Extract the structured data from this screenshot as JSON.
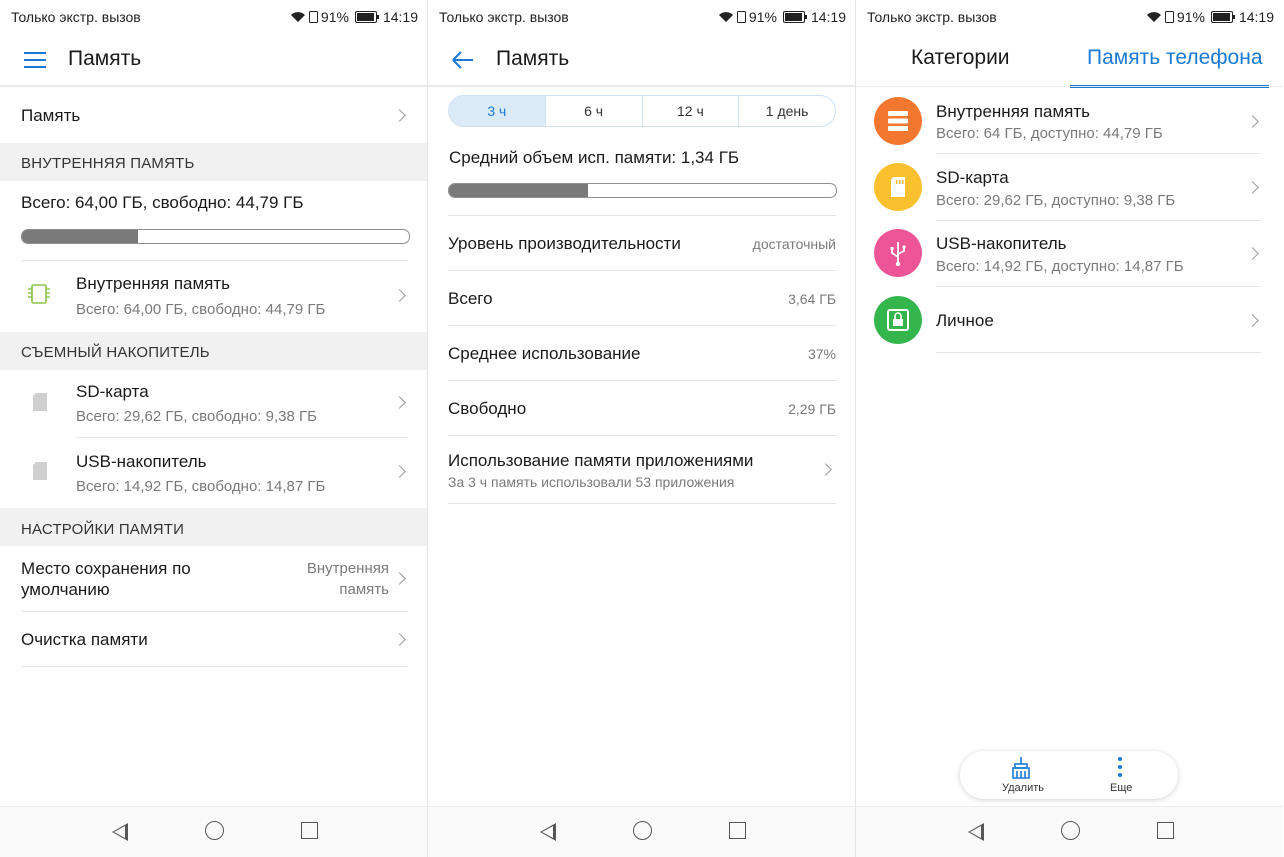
{
  "status": {
    "carrier": "Только экстр. вызов",
    "battery": "91%",
    "time": "14:19"
  },
  "screen1": {
    "title": "Память",
    "memory_row": "Память",
    "section_internal": "ВНУТРЕННЯЯ ПАМЯТЬ",
    "internal_summary": "Всего: 64,00 ГБ, свободно: 44,79 ГБ",
    "internal_used_fraction": 0.3,
    "internal_item": {
      "title": "Внутренняя память",
      "sub": "Всего: 64,00 ГБ, свободно: 44,79 ГБ"
    },
    "section_removable": "СЪЕМНЫЙ НАКОПИТЕЛЬ",
    "sd": {
      "title": "SD-карта",
      "sub": "Всего: 29,62 ГБ, свободно: 9,38 ГБ"
    },
    "usb": {
      "title": "USB-накопитель",
      "sub": "Всего: 14,92 ГБ, свободно: 14,87 ГБ"
    },
    "section_settings": "НАСТРОЙКИ ПАМЯТИ",
    "default_location": {
      "title": "Место сохранения по умолчанию",
      "value": "Внутренняя память"
    },
    "cleanup": "Очистка памяти"
  },
  "screen2": {
    "title": "Память",
    "ranges": [
      "3 ч",
      "6 ч",
      "12 ч",
      "1 день"
    ],
    "avg_usage": "Средний объем исп. памяти: 1,34 ГБ",
    "avg_usage_fraction": 0.36,
    "performance": {
      "label": "Уровень производительности",
      "value": "достаточный"
    },
    "total": {
      "label": "Всего",
      "value": "3,64 ГБ"
    },
    "average": {
      "label": "Среднее использование",
      "value": "37%"
    },
    "free": {
      "label": "Свободно",
      "value": "2,29 ГБ"
    },
    "apps": {
      "title": "Использование памяти приложениями",
      "sub": "За 3 ч память использовали 53 приложения"
    }
  },
  "screen3": {
    "tab_categories": "Категории",
    "tab_phone": "Память телефона",
    "items": [
      {
        "title": "Внутренняя память",
        "sub": "Всего: 64 ГБ, доступно: 44,79 ГБ",
        "color": "#f4772f"
      },
      {
        "title": "SD-карта",
        "sub": "Всего: 29,62 ГБ, доступно: 9,38 ГБ",
        "color": "#fbc02d"
      },
      {
        "title": "USB-накопитель",
        "sub": "Всего: 14,92 ГБ, доступно: 14,87 ГБ",
        "color": "#ee5596"
      },
      {
        "title": "Личное",
        "sub": "",
        "color": "#35b64d"
      }
    ],
    "delete": "Удалить",
    "more": "Еще"
  },
  "colors": {
    "accent": "#1a7ad6"
  }
}
